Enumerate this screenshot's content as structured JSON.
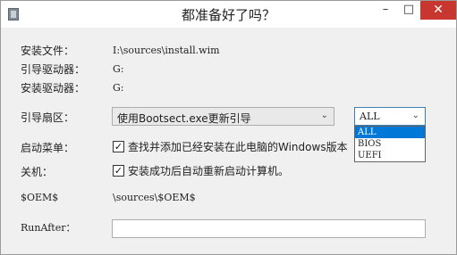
{
  "window": {
    "title": "都准备好了吗？"
  },
  "titlebar": {
    "minimize": "–",
    "maximize": "□",
    "close": "✕"
  },
  "fields": {
    "install_file_label": "安装文件：",
    "install_file_value": "I:\\sources\\install.wim",
    "boot_drive_label": "引导驱动器：",
    "boot_drive_value": "G:",
    "install_drive_label": "安装驱动器：",
    "install_drive_value": "G:"
  },
  "boot_sector": {
    "label": "引导扇区：",
    "method_selected": "使用Bootsect.exe更新引导",
    "firmware_selected": "ALL",
    "firmware_options": [
      "ALL",
      "BIOS",
      "UEFI"
    ]
  },
  "boot_menu": {
    "label": "启动菜单：",
    "checked": true,
    "text": "查找并添加已经安装在此电脑的Windows版本"
  },
  "shutdown": {
    "label": "关机：",
    "checked": true,
    "text": "安装成功后自动重新启动计算机。"
  },
  "oem": {
    "label": "$OEM$",
    "value": "\\sources\\$OEM$"
  },
  "run_after": {
    "label": "RunAfter：",
    "value": ""
  },
  "icons": {
    "app": "app-icon",
    "dropdown_arrow": "chevron-down-icon",
    "check": "check-icon"
  }
}
